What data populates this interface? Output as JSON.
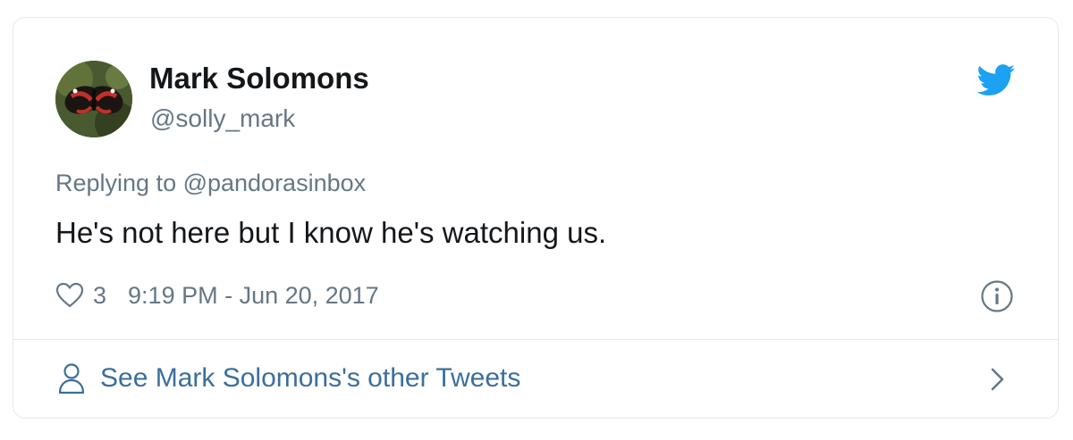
{
  "tweet": {
    "author_name": "Mark Solomons",
    "author_handle": "@solly_mark",
    "replying_to": "Replying to @pandorasinbox",
    "text": "He's not here but I know he's watching us.",
    "like_count": "3",
    "timestamp": "9:19 PM - Jun 20, 2017"
  },
  "footer": {
    "other_tweets_label": "See Mark Solomons's other Tweets"
  },
  "icons": {
    "brand": "twitter-bird-icon",
    "like": "heart-icon",
    "info": "info-icon",
    "profile": "person-icon",
    "more": "chevron-right-icon"
  },
  "colors": {
    "text_primary": "#14171a",
    "text_secondary": "#657786",
    "link": "#3b6e9c",
    "brand_blue": "#1da1f2",
    "border": "#e1e8ed"
  }
}
